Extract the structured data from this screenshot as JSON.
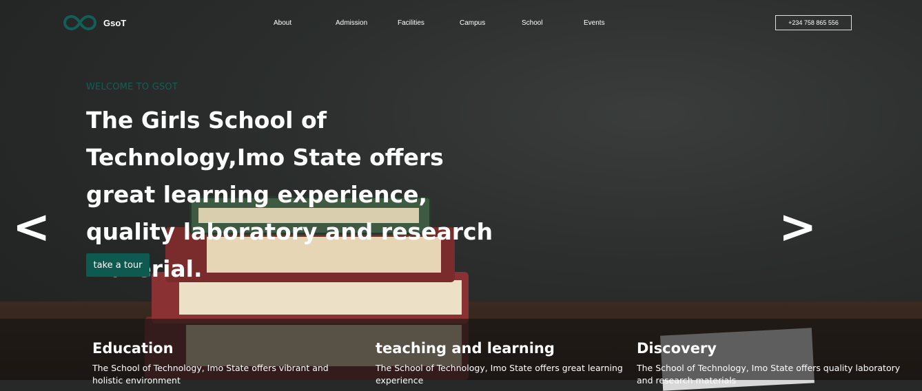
{
  "brand": {
    "name": "GsoT",
    "logo_icon": "infinity-icon",
    "accent": "#135f57"
  },
  "nav": {
    "items": [
      "About",
      "Admission",
      "Facilities",
      "Campus",
      "School",
      "Events"
    ]
  },
  "phone": "+234 758 865 556",
  "hero": {
    "welcome": "WELCOME TO GSOT",
    "headline": "The Girls School of Technology,Imo State offers great learning experience, quality laboratory and research material.",
    "cta": "take a tour",
    "prev": "<",
    "next": ">"
  },
  "features": [
    {
      "title": "Education",
      "text": "The School of Technology, Imo State offers vibrant and holistic environment"
    },
    {
      "title": "teaching and learning",
      "text": "The School of Technology, Imo State offers great learning experience"
    },
    {
      "title": "Discovery",
      "text": "The School of Technology, Imo State offers quality laboratory and research materials"
    }
  ],
  "colors": {
    "cta_bg": "#0e5a50",
    "welcome_text": "#135f57"
  }
}
